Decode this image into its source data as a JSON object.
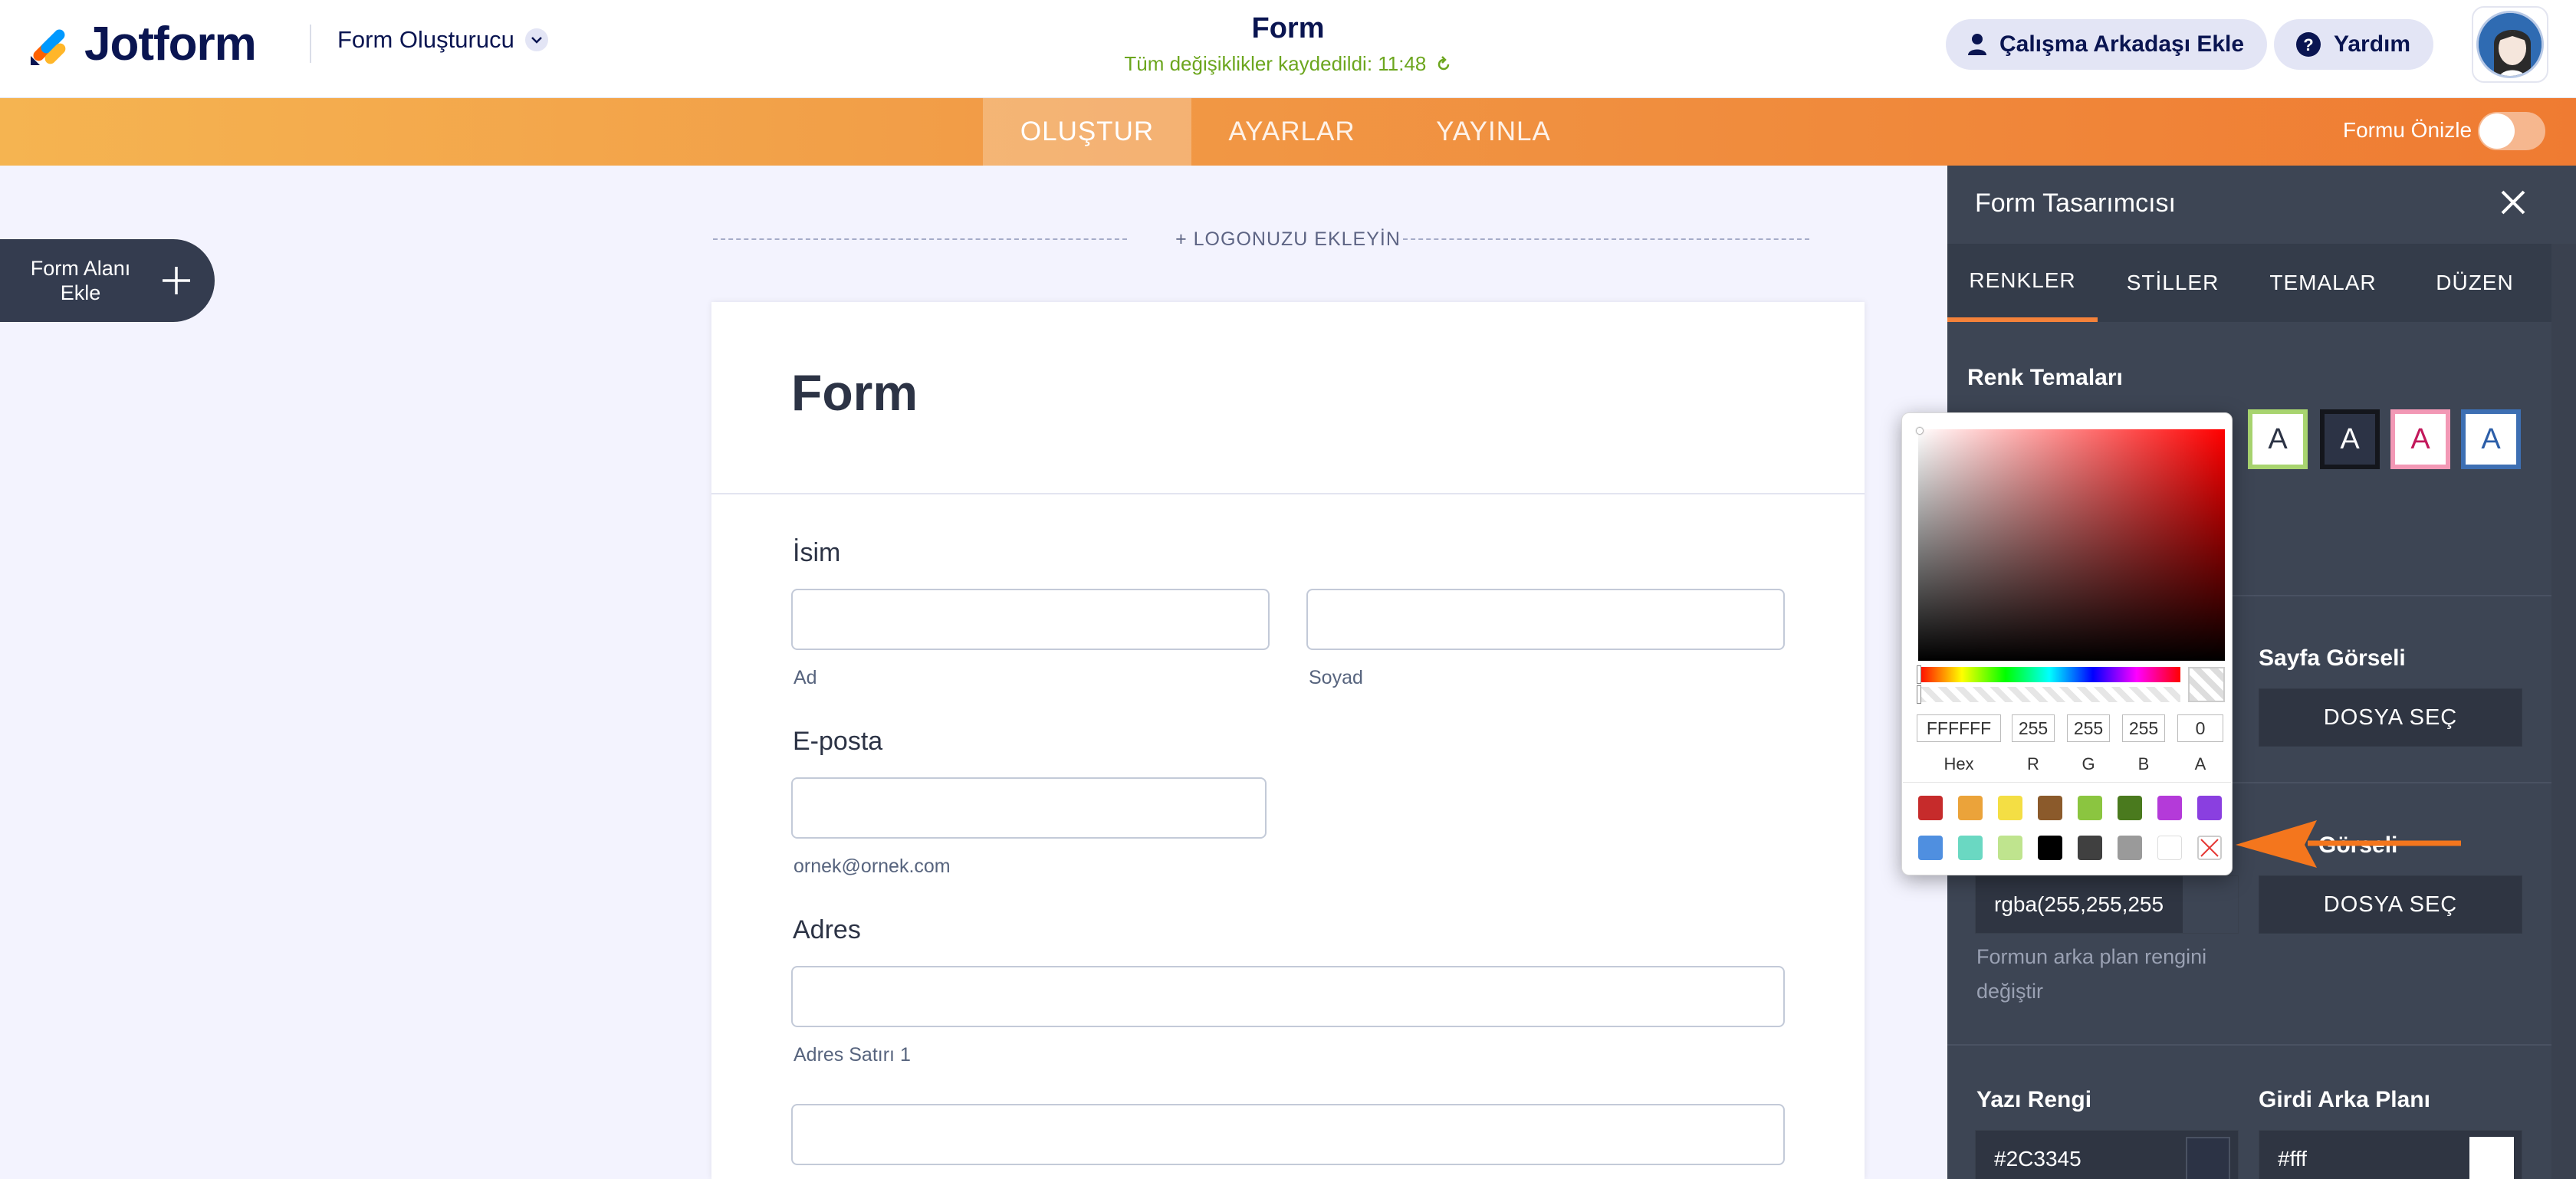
{
  "header": {
    "brand": "Jotform",
    "builder_menu": "Form Oluşturucu",
    "form_title": "Form",
    "save_status": "Tüm değişiklikler kaydedildi: 11:48",
    "collab_button": "Çalışma Arkadaşı Ekle",
    "help_button": "Yardım"
  },
  "nav": {
    "tabs": [
      "OLUŞTUR",
      "AYARLAR",
      "YAYINLA"
    ],
    "active_tab": "OLUŞTUR",
    "preview_label": "Formu Önizle",
    "preview_on": false
  },
  "left": {
    "add_field_line1": "Form Alanı",
    "add_field_line2": "Ekle"
  },
  "form": {
    "add_logo": "+ LOGONUZU EKLEYİN",
    "heading": "Form",
    "fields": {
      "name_label": "İsim",
      "first_sub": "Ad",
      "last_sub": "Soyad",
      "email_label": "E-posta",
      "email_sub": "ornek@ornek.com",
      "address_label": "Adres",
      "address_sub": "Adres Satırı 1"
    }
  },
  "designer": {
    "title": "Form Tasarımcısı",
    "tabs": [
      "RENKLER",
      "STİLLER",
      "TEMALAR",
      "DÜZEN"
    ],
    "active_tab": "RENKLER",
    "color_themes_label": "Renk Temaları",
    "theme_swatches": [
      {
        "letter": "A",
        "bg": "#ffffff",
        "border": "#a8d46f",
        "color": "#2c3345"
      },
      {
        "letter": "A",
        "bg": "#2c3345",
        "border": "#14161c",
        "color": "#ffffff"
      },
      {
        "letter": "A",
        "bg": "#ffffff",
        "border": "#f298b5",
        "color": "#c2185b"
      },
      {
        "letter": "A",
        "bg": "#ffffff",
        "border": "#3d6fb3",
        "color": "#2c5ea8"
      }
    ],
    "page_image_label": "Sayfa Görseli",
    "file_select_1": "DOSYA SEÇ",
    "form_image_label_partial": "Görseli",
    "file_select_2": "DOSYA SEÇ",
    "bg_color_value": "rgba(255,255,255",
    "bg_help": "Formun arka plan rengini değiştir",
    "text_color_label": "Yazı Rengi",
    "text_color_value": "#2C3345",
    "input_bg_label": "Girdi Arka Planı",
    "input_bg_value": "#fff"
  },
  "picker": {
    "hex": "FFFFFF",
    "r": "255",
    "g": "255",
    "b": "255",
    "a": "0",
    "labels": [
      "Hex",
      "R",
      "G",
      "B",
      "A"
    ],
    "swatches_row1": [
      "#c62b2b",
      "#eba33a",
      "#f4de44",
      "#8b5a2b",
      "#8bc540",
      "#4a7a1e",
      "#b43ad9",
      "#8a3fe0"
    ],
    "swatches_row2": [
      "#4f8fe0",
      "#6ad8c2",
      "#bfe48e",
      "#000000",
      "#404040",
      "#9a9a9a",
      "#ffffff",
      "transparent"
    ]
  }
}
